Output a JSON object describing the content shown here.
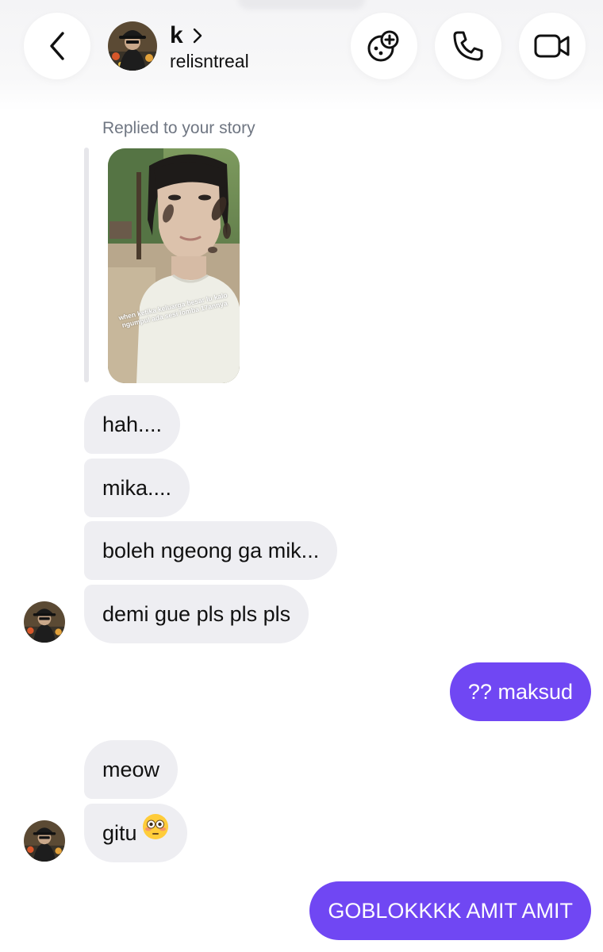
{
  "header": {
    "name": "k",
    "username": "relisntreal",
    "icons": {
      "back": "chevron-left-icon",
      "game": "game-controller-plus-icon",
      "call": "phone-icon",
      "video": "video-camera-icon"
    }
  },
  "story_reply": {
    "label": "Replied to your story",
    "caption": "when ketika keluarga besar lu kalo ngumpul ada sesi lomba 17annya"
  },
  "messages": [
    {
      "from": "them",
      "text": "hah...."
    },
    {
      "from": "them",
      "text": "mika...."
    },
    {
      "from": "them",
      "text": "boleh ngeong ga mik..."
    },
    {
      "from": "them",
      "text": "demi gue pls pls pls"
    },
    {
      "from": "me",
      "text": "?? maksud"
    },
    {
      "from": "them",
      "text": "meow"
    },
    {
      "from": "them",
      "text": "gitu",
      "emoji": "flushed-face-emoji"
    },
    {
      "from": "me",
      "text": "GOBLOKKKK AMIT AMIT"
    }
  ],
  "colors": {
    "outgoing_bubble": "#7047f3",
    "incoming_bubble": "#eeeef2",
    "secondary_text": "#6f7682"
  }
}
